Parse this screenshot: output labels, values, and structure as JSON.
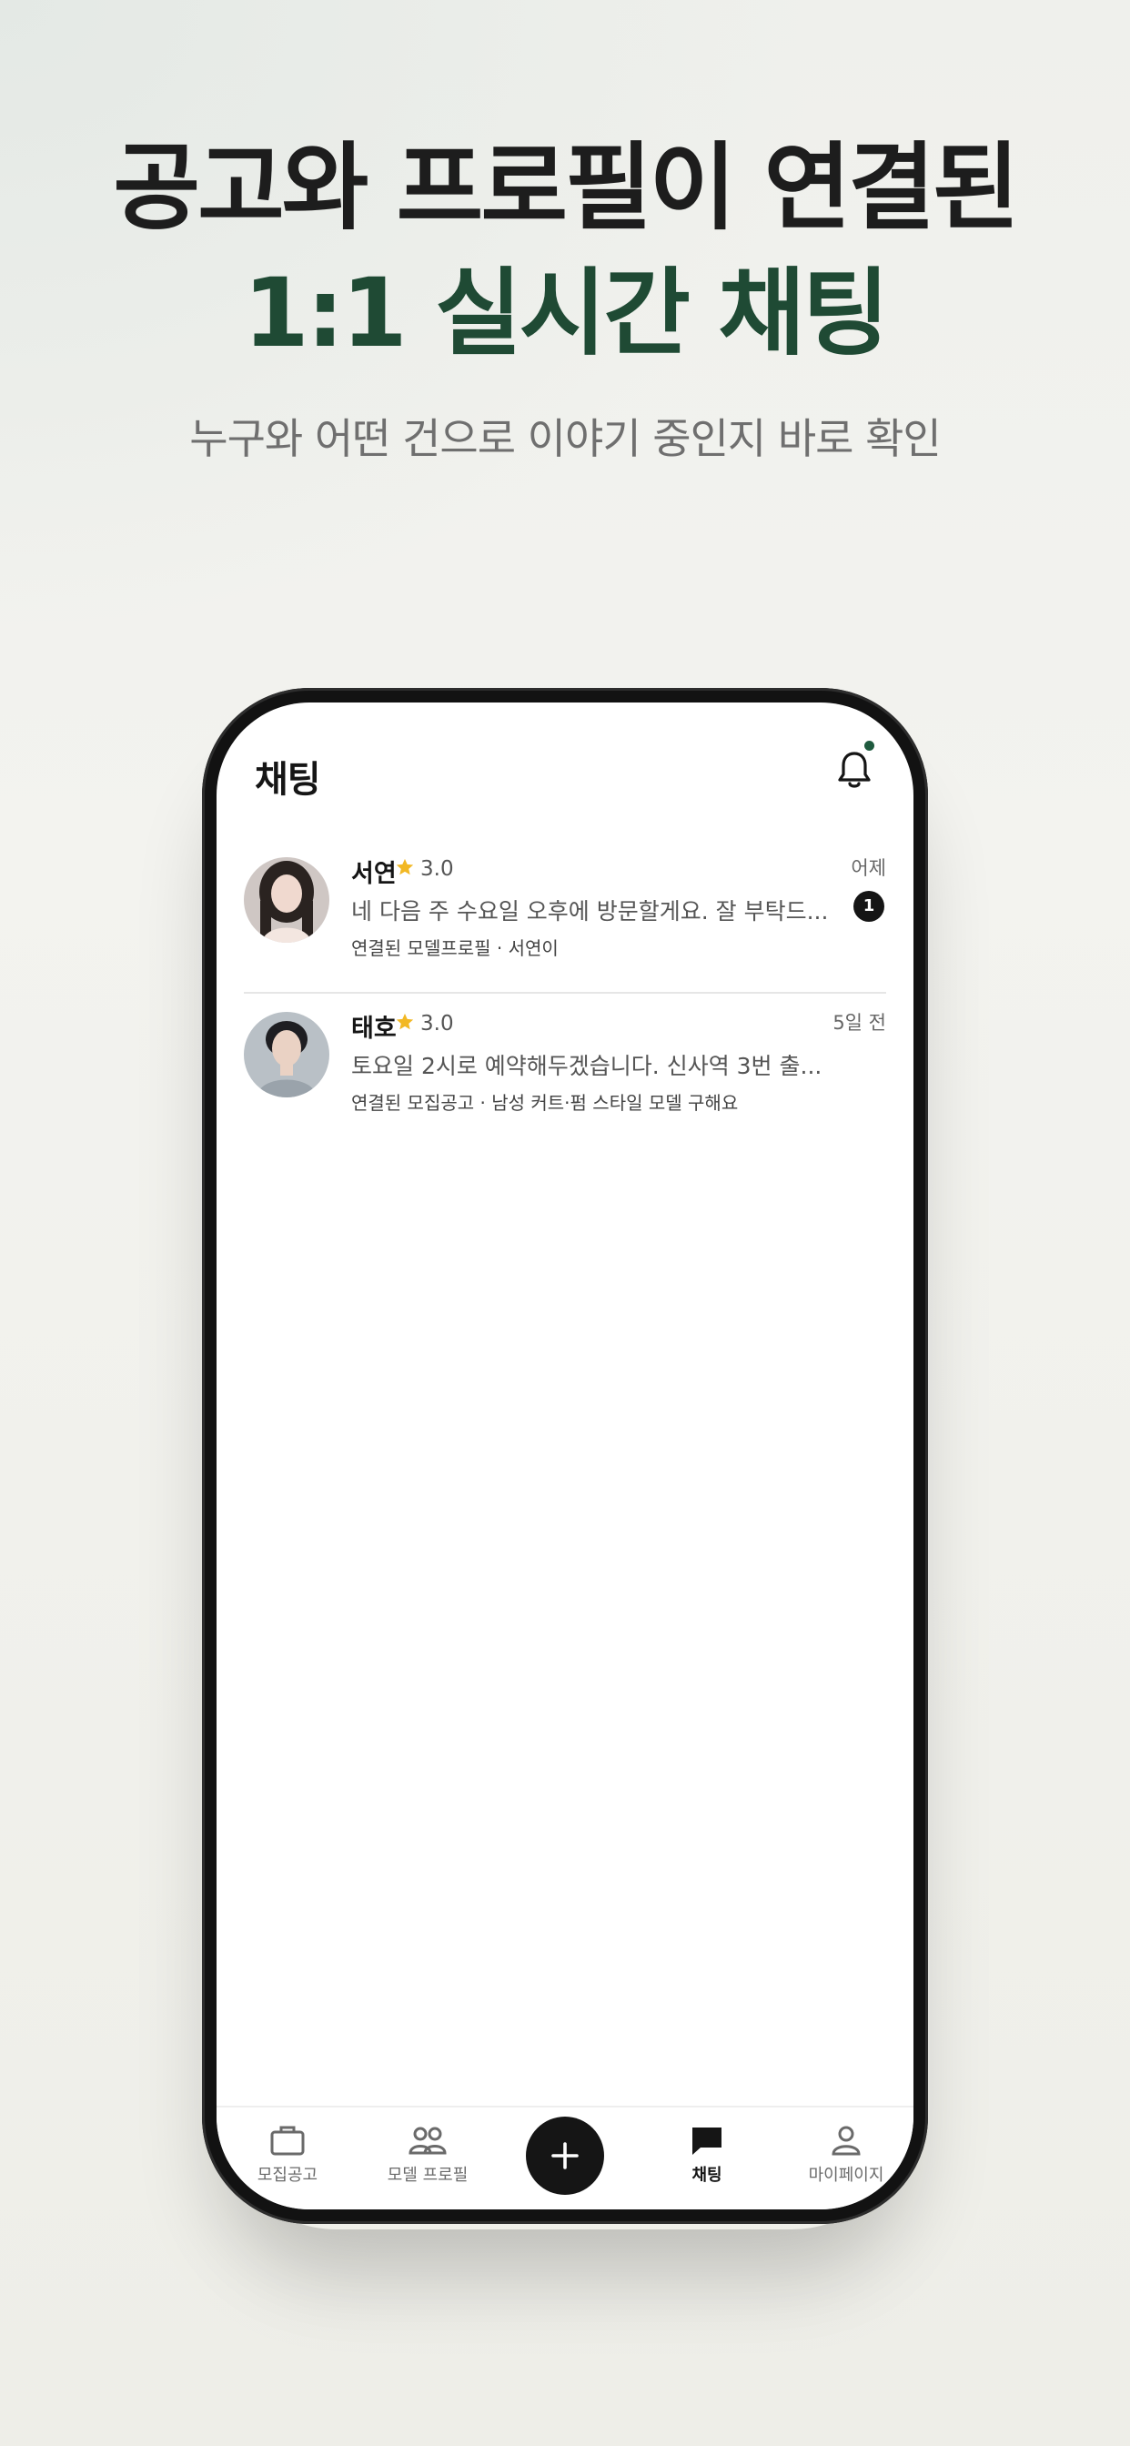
{
  "hero": {
    "line1": "공고와 프로필이 연결된",
    "line2": "1:1 실시간 채팅",
    "subtitle": "누구와 어떤 건으로 이야기 중인지 바로 확인"
  },
  "screen": {
    "title": "채팅",
    "notification": {
      "icon": "bell-icon",
      "has_unread": true
    }
  },
  "chats": [
    {
      "name": "서연",
      "rating": "3.0",
      "time": "어제",
      "message": "네 다음 주 수요일 오후에 방문할게요. 잘 부탁드...",
      "linked": "연결된 모델프로필 · 서연이",
      "unread": "1"
    },
    {
      "name": "태호",
      "rating": "3.0",
      "time": "5일 전",
      "message": "토요일 2시로 예약해두겠습니다. 신사역 3번 출...",
      "linked": "연결된 모집공고 · 남성 커트·펌 스타일 모델 구해요"
    }
  ],
  "tabbar": {
    "tabs": [
      {
        "label": "모집공고",
        "icon": "briefcase-icon",
        "active": false
      },
      {
        "label": "모델 프로필",
        "icon": "people-icon",
        "active": false
      },
      {
        "label": "",
        "icon": "plus-icon",
        "active": false
      },
      {
        "label": "채팅",
        "icon": "chat-bubble-icon",
        "active": true
      },
      {
        "label": "마이페이지",
        "icon": "person-icon",
        "active": false
      }
    ]
  },
  "colors": {
    "brand_green": "#1f4a34",
    "star": "#f2b824",
    "dark": "#151515"
  }
}
